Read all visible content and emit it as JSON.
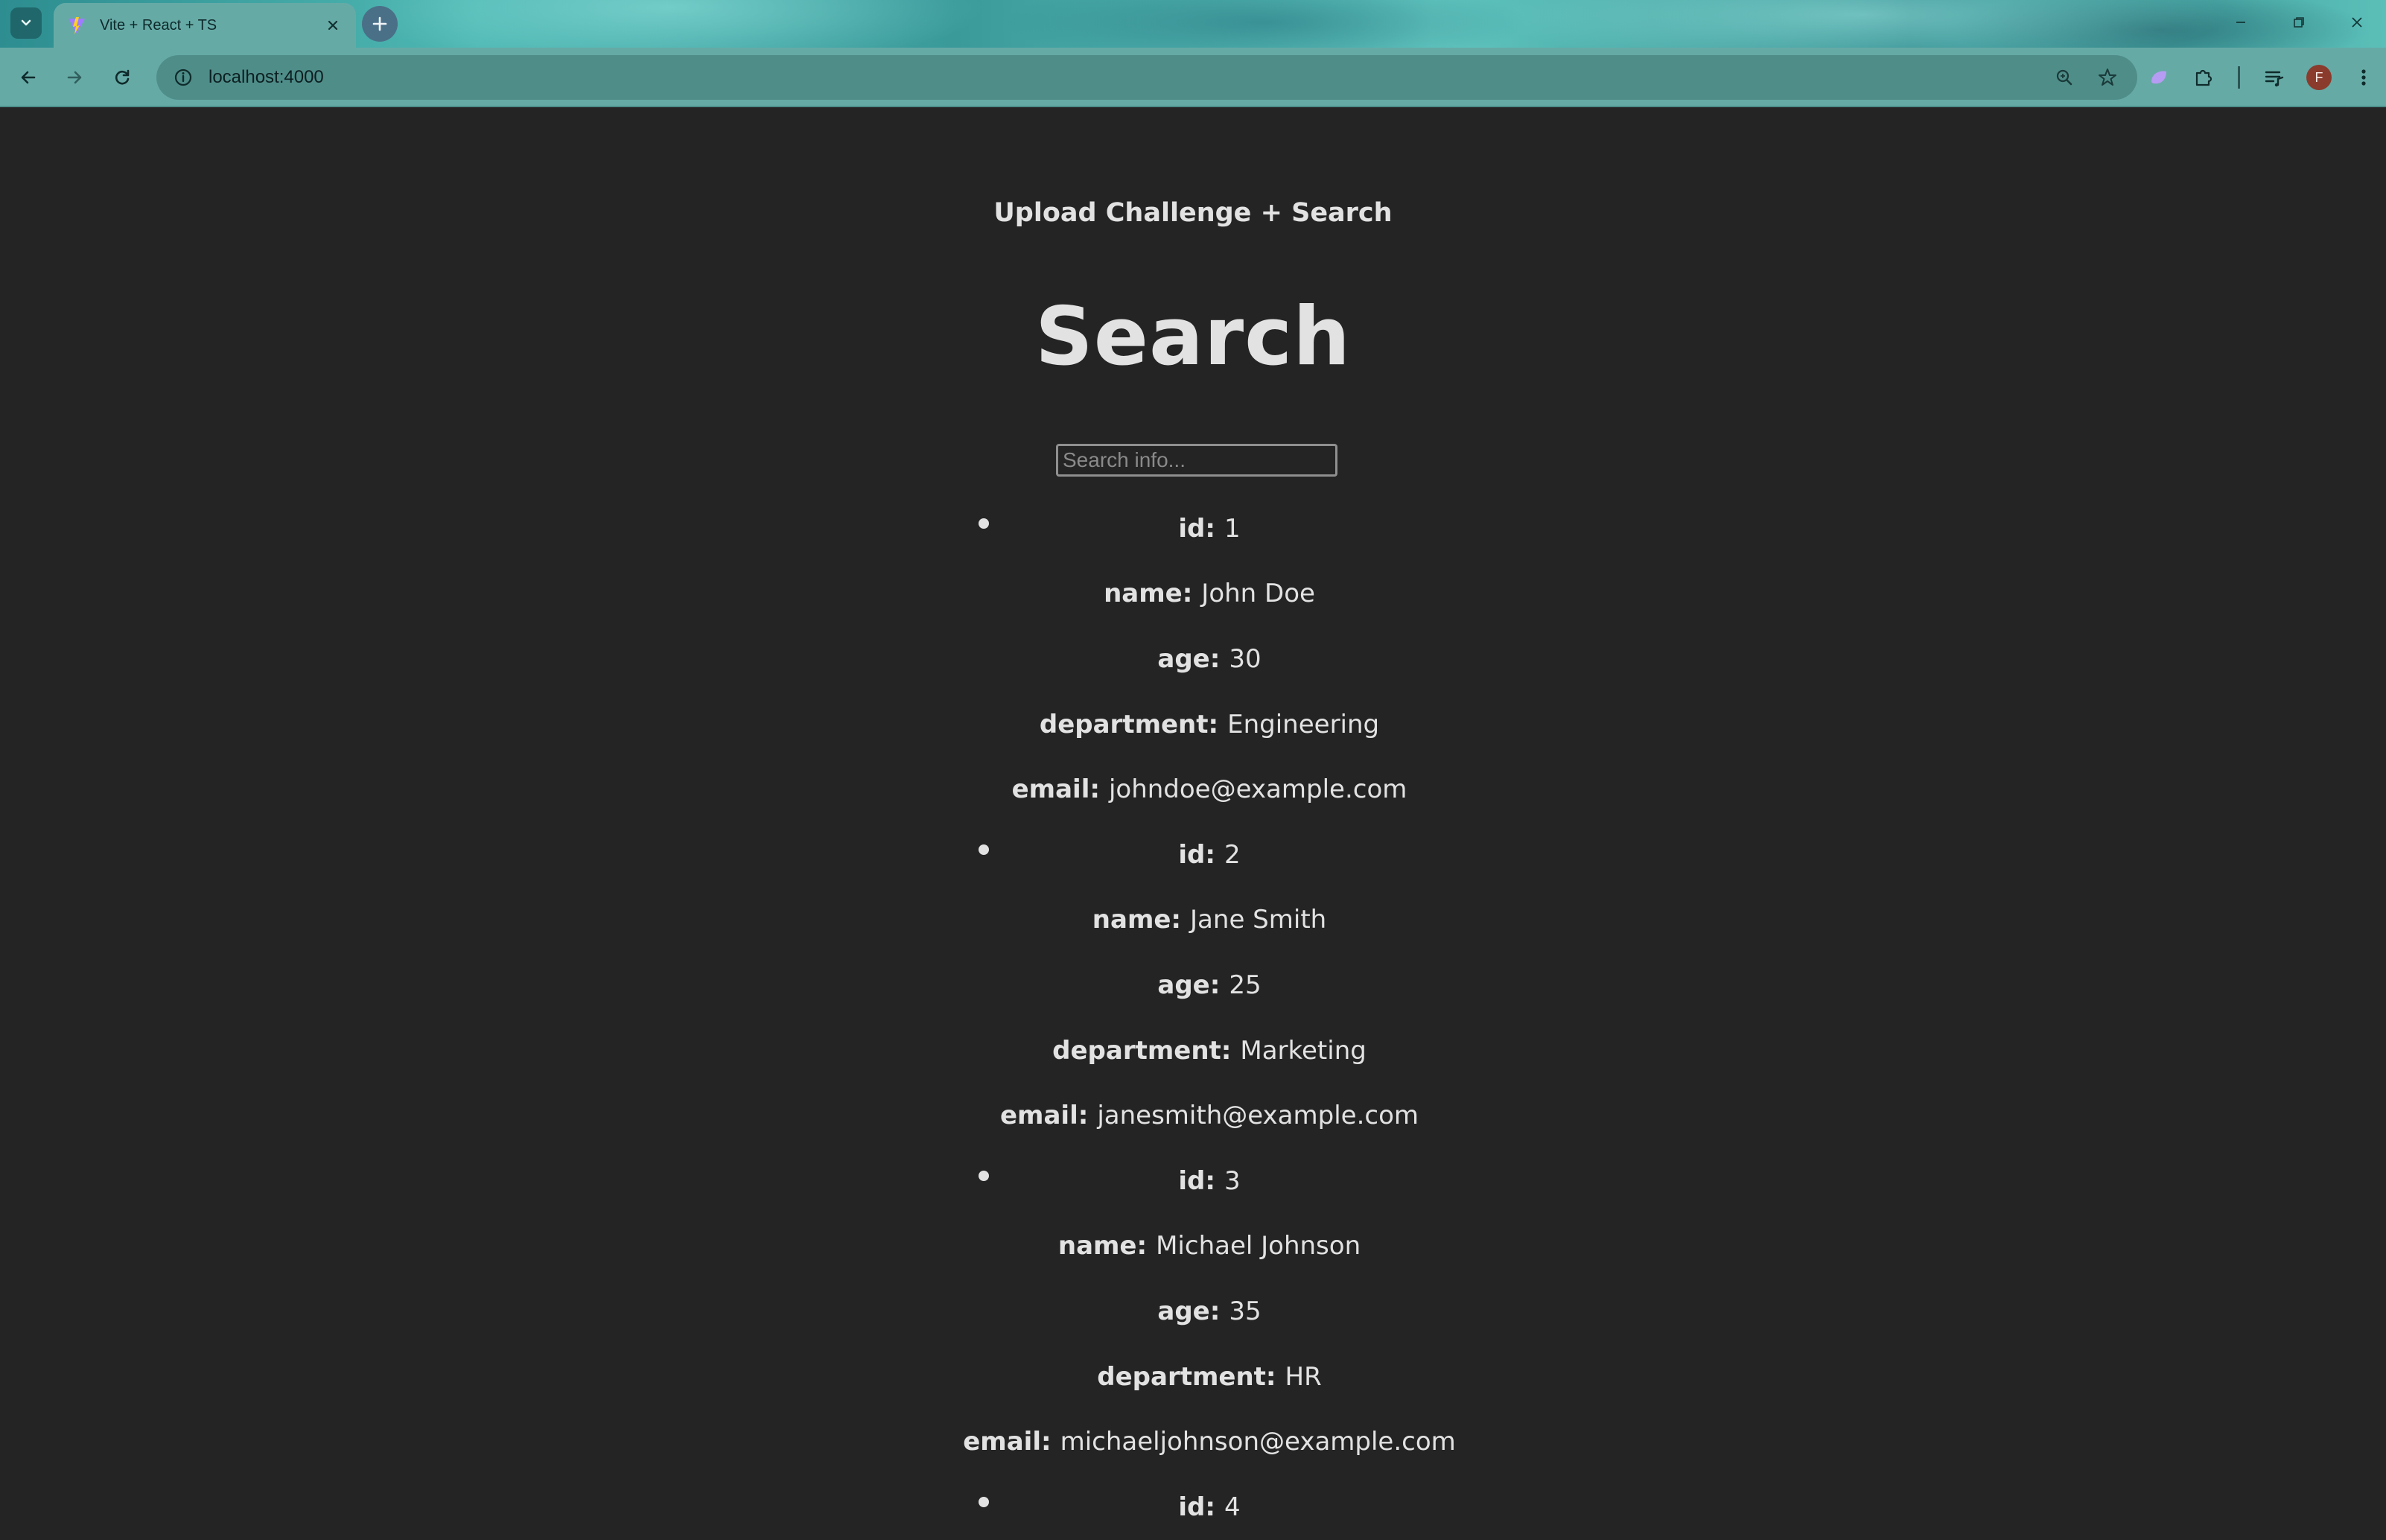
{
  "browser": {
    "tab_title": "Vite + React + TS",
    "url": "localhost:4000",
    "avatar_initial": "F"
  },
  "page": {
    "app_title": "Upload Challenge + Search",
    "section_title": "Search",
    "search": {
      "placeholder": "Search info...",
      "value": ""
    }
  },
  "results": [
    {
      "id": {
        "label": "id:",
        "value": "1"
      },
      "name": {
        "label": "name:",
        "value": "John Doe"
      },
      "age": {
        "label": "age:",
        "value": "30"
      },
      "department": {
        "label": "department:",
        "value": "Engineering"
      },
      "email": {
        "label": "email:",
        "value": "johndoe@example.com"
      }
    },
    {
      "id": {
        "label": "id:",
        "value": "2"
      },
      "name": {
        "label": "name:",
        "value": "Jane Smith"
      },
      "age": {
        "label": "age:",
        "value": "25"
      },
      "department": {
        "label": "department:",
        "value": "Marketing"
      },
      "email": {
        "label": "email:",
        "value": "janesmith@example.com"
      }
    },
    {
      "id": {
        "label": "id:",
        "value": "3"
      },
      "name": {
        "label": "name:",
        "value": "Michael Johnson"
      },
      "age": {
        "label": "age:",
        "value": "35"
      },
      "department": {
        "label": "department:",
        "value": "HR"
      },
      "email": {
        "label": "email:",
        "value": "michaeljohnson@example.com"
      }
    },
    {
      "id": {
        "label": "id:",
        "value": "4"
      }
    }
  ]
}
